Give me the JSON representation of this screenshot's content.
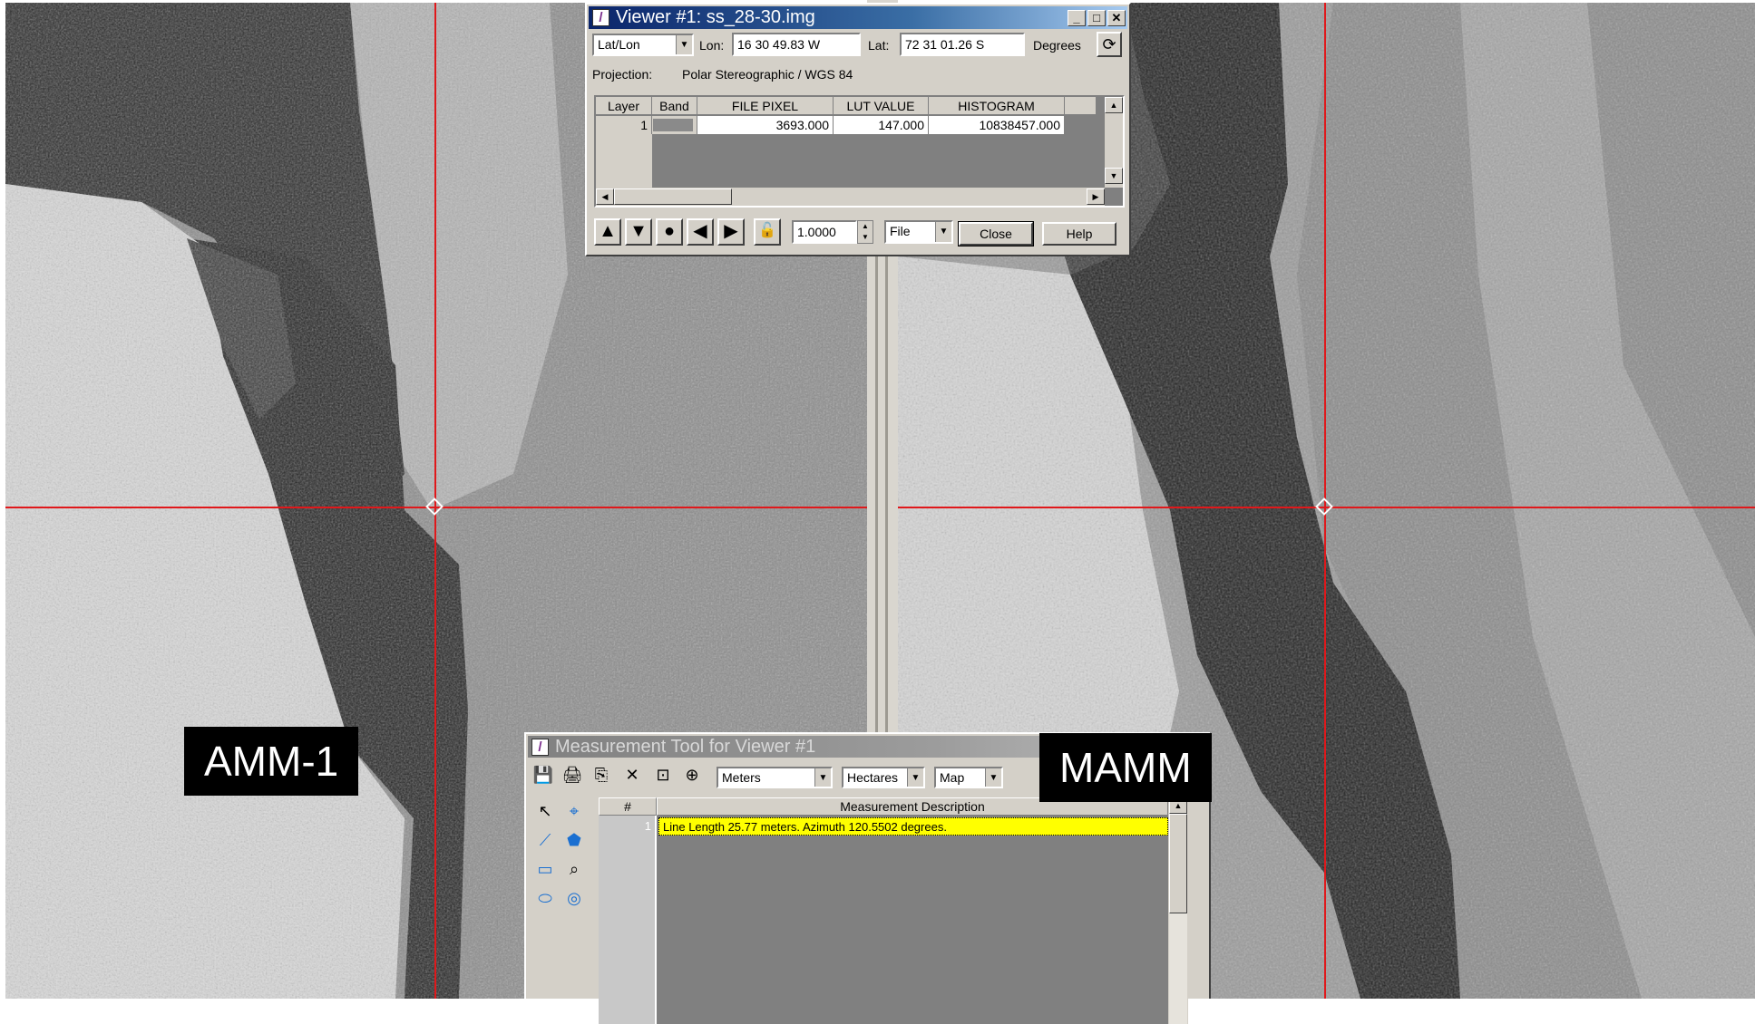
{
  "labels": {
    "left_image": "AMM-1",
    "right_image": "MAMM"
  },
  "viewer": {
    "title": "Viewer #1:  ss_28-30.img",
    "coord_system": "Lat/Lon",
    "lon_label": "Lon:",
    "lon_value": "16 30 49.83 W",
    "lat_label": "Lat:",
    "lat_value": "72 31 01.26 S",
    "units_label": "Degrees",
    "projection_label": "Projection:",
    "projection_value": "Polar Stereographic / WGS 84",
    "table": {
      "columns": [
        "Layer",
        "Band",
        "FILE PIXEL",
        "LUT VALUE",
        "HISTOGRAM"
      ],
      "rows": [
        {
          "layer": "1",
          "band": "",
          "file_pixel": "3693.000",
          "lut_value": "147.000",
          "histogram": "10838457.000"
        }
      ]
    },
    "zoom_value": "1.0000",
    "pixel_source": "File",
    "close_label": "Close",
    "help_label": "Help"
  },
  "measurement": {
    "title": "Measurement Tool for Viewer #1",
    "length_units": "Meters",
    "area_units": "Hectares",
    "coord_type": "Map",
    "columns": [
      "#",
      "Measurement Description"
    ],
    "rows": [
      {
        "num": "1",
        "description": "Line Length 25.77 meters. Azimuth 120.5502 degrees."
      }
    ]
  },
  "colors": {
    "crosshair": "#e0181b",
    "highlight_row": "#ffff00",
    "title_active": "#0a246a"
  },
  "icons": {
    "viewer_app": "imagine-app-icon",
    "refresh": "refresh-icon",
    "up": "triangle-up-icon",
    "down": "triangle-down-icon",
    "center": "circle-icon",
    "left": "triangle-left-icon",
    "right": "triangle-right-icon",
    "lock": "lock-icon"
  }
}
